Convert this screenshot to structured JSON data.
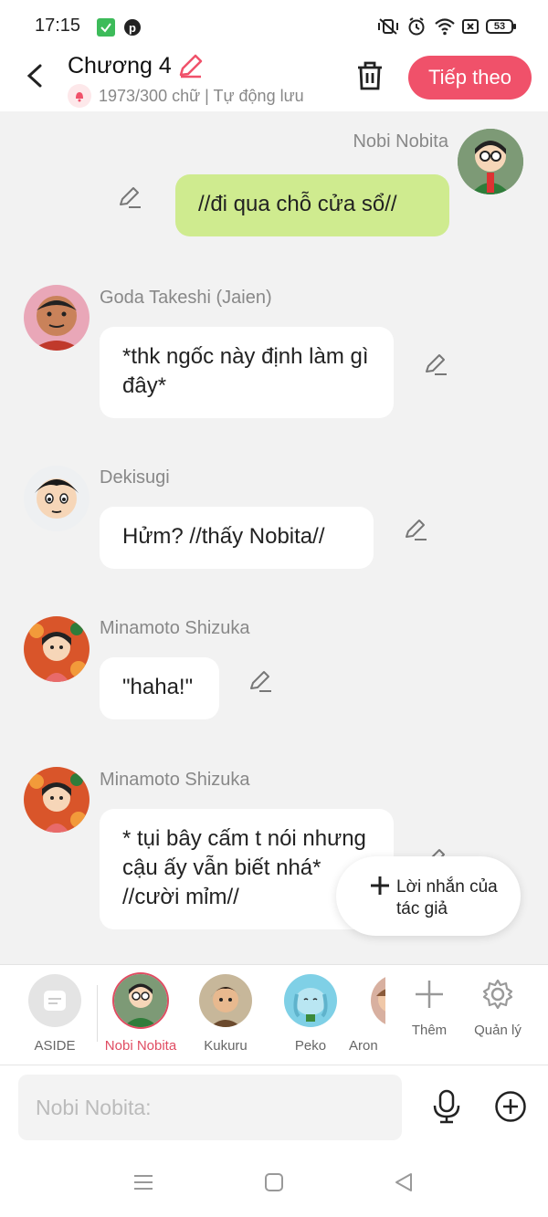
{
  "status": {
    "time": "17:15",
    "battery": "53"
  },
  "header": {
    "title": "Chương 4",
    "subtitle": "1973/300 chữ | Tự động lưu",
    "next_label": "Tiếp theo"
  },
  "messages": [
    {
      "sender": "Nobi Nobita",
      "text": "//đi qua chỗ cửa sổ//",
      "mine": true
    },
    {
      "sender": "Goda Takeshi (Jaien)",
      "text": "*thk ngốc này định làm gì đây*"
    },
    {
      "sender": "Dekisugi",
      "text": "Hửm? //thấy Nobita//"
    },
    {
      "sender": "Minamoto Shizuka",
      "text": "\"haha!\""
    },
    {
      "sender": "Minamoto Shizuka",
      "text": "* tụi bây cấm t nói nhưng cậu ấy vẫn biết nhá* //cười mỉm//"
    }
  ],
  "author_note": {
    "label": "Lời nhắn của tác giả"
  },
  "characters": [
    {
      "name": "ASIDE"
    },
    {
      "name": "Nobi Nobita",
      "active": true
    },
    {
      "name": "Kukuru"
    },
    {
      "name": "Peko"
    },
    {
      "name": "Aron"
    }
  ],
  "tools": {
    "add_label": "Thêm",
    "manage_label": "Quản lý"
  },
  "input": {
    "placeholder": "Nobi Nobita:"
  },
  "colors": {
    "accent": "#f0516a",
    "my_bubble": "#cfeb8f",
    "background": "#f2f2f2"
  }
}
